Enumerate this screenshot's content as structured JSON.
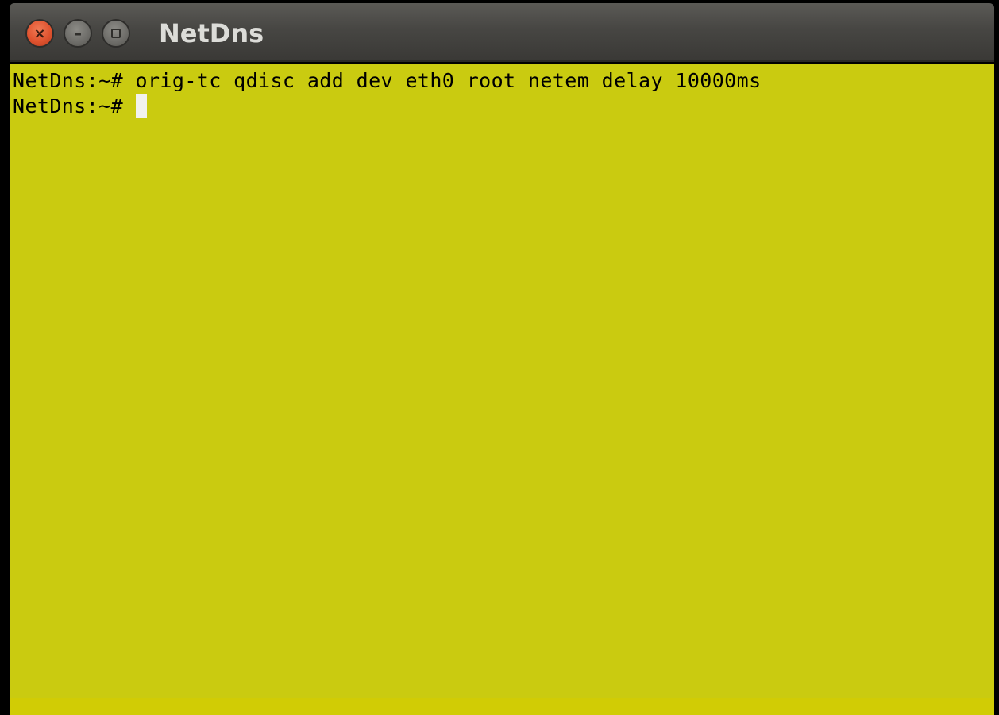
{
  "window": {
    "title": "NetDns",
    "buttons": {
      "close_icon": "close-icon",
      "minimize_icon": "minimize-icon",
      "maximize_icon": "maximize-icon"
    }
  },
  "terminal": {
    "background_color": "#cacb10",
    "text_color": "#000000",
    "lines": [
      {
        "prompt": "NetDns:~# ",
        "command": "orig-tc qdisc add dev eth0 root netem delay 10000ms"
      },
      {
        "prompt": "NetDns:~# ",
        "command": ""
      }
    ]
  }
}
